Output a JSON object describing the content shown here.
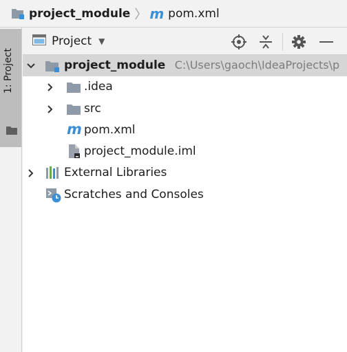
{
  "breadcrumb": {
    "project": "project_module",
    "file": "pom.xml",
    "maven_letter": "m"
  },
  "stripe": {
    "tab_label": "1: Project"
  },
  "toolwindow": {
    "view_label": "Project",
    "icons": [
      "locate-icon",
      "collapse-all-icon",
      "gear-icon",
      "minimize-icon"
    ]
  },
  "tree": {
    "root": {
      "name": "project_module",
      "path": "C:\\Users\\gaoch\\IdeaProjects\\p"
    },
    "items": [
      {
        "name": ".idea",
        "type": "folder"
      },
      {
        "name": "src",
        "type": "folder"
      },
      {
        "name": "pom.xml",
        "type": "maven"
      },
      {
        "name": "project_module.iml",
        "type": "iml"
      }
    ],
    "external": "External Libraries",
    "scratches": "Scratches and Consoles"
  },
  "colors": {
    "accent_blue": "#3a8fd6",
    "selection": "#d6d6d6",
    "folder_gray": "#8e9aa8"
  }
}
